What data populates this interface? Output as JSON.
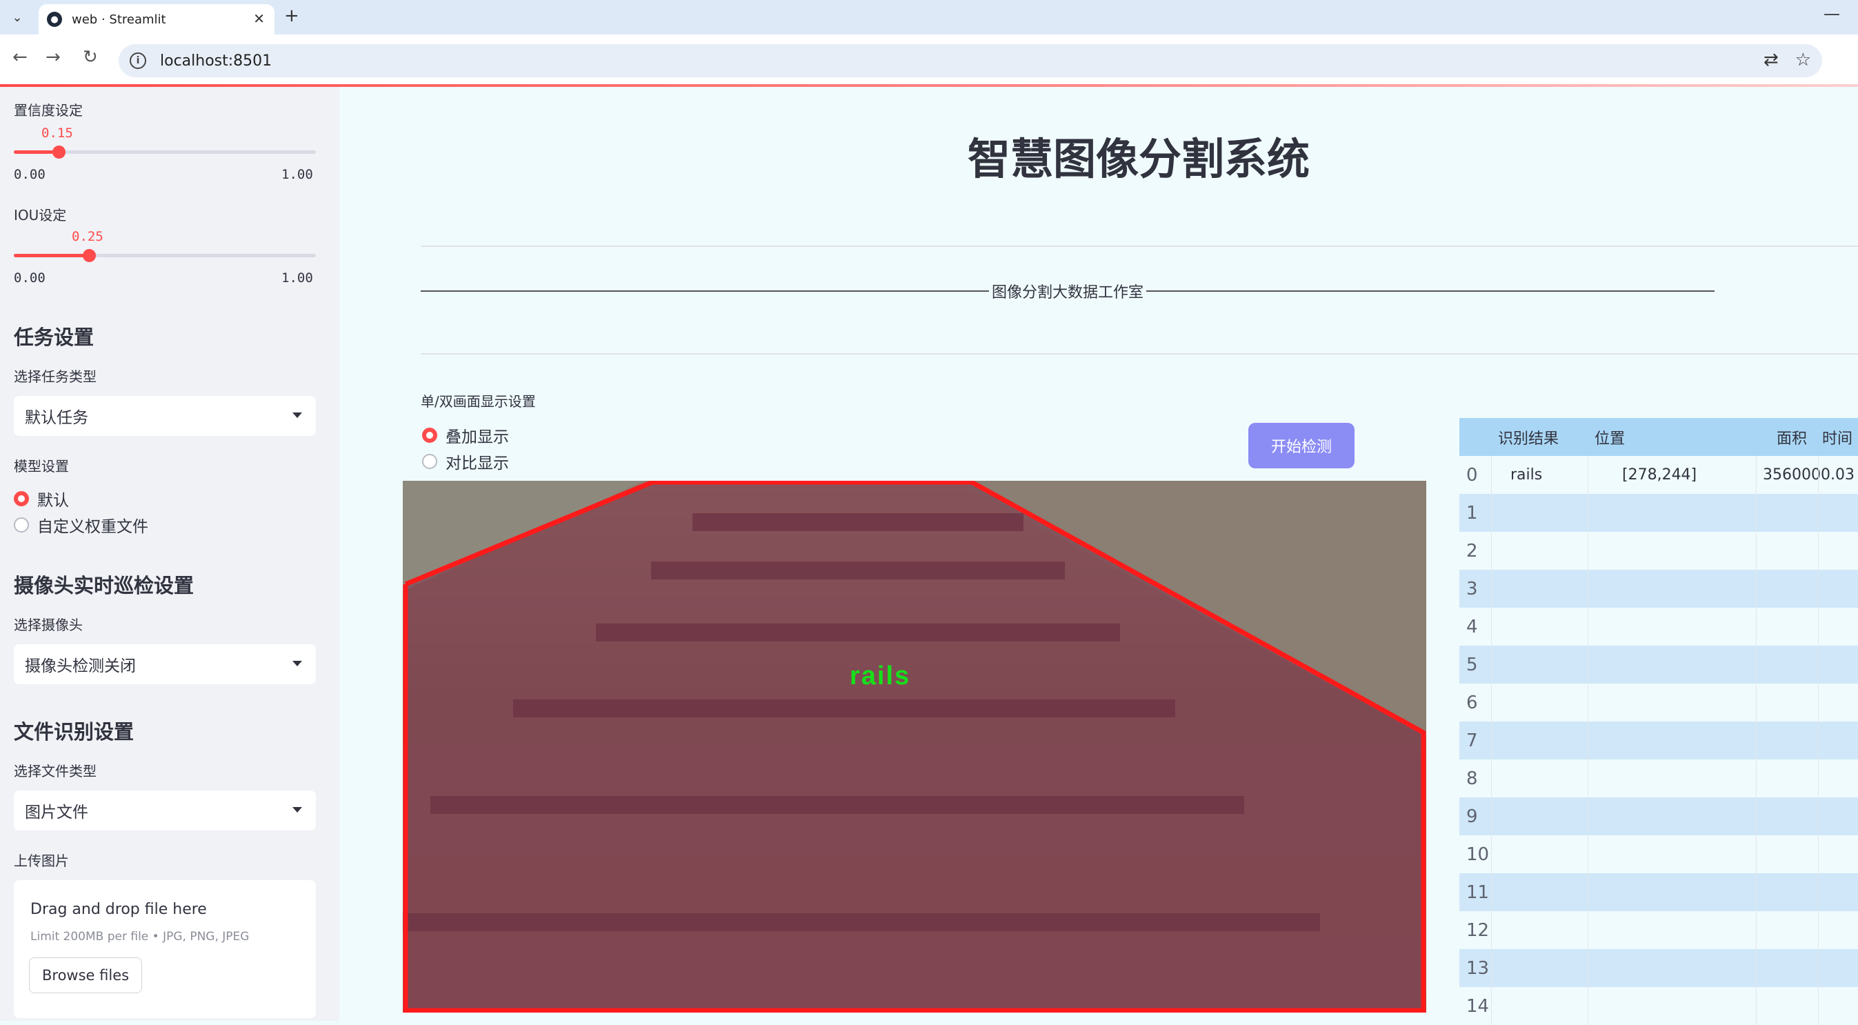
{
  "browser": {
    "tab_title": "web · Streamlit",
    "url": "localhost:8501"
  },
  "sidebar": {
    "confidence": {
      "label": "置信度设定",
      "value": "0.15",
      "min": "0.00",
      "max": "1.00",
      "fraction": 0.15
    },
    "iou": {
      "label": "IOU设定",
      "value": "0.25",
      "min": "0.00",
      "max": "1.00",
      "fraction": 0.25
    },
    "task_section": "任务设置",
    "task_type_label": "选择任务类型",
    "task_type_value": "默认任务",
    "model_label": "模型设置",
    "model_options": [
      "默认",
      "自定义权重文件"
    ],
    "camera_section": "摄像头实时巡检设置",
    "camera_label": "选择摄像头",
    "camera_value": "摄像头检测关闭",
    "file_section": "文件识别设置",
    "file_type_label": "选择文件类型",
    "file_type_value": "图片文件",
    "upload_label": "上传图片",
    "upload": {
      "title": "Drag and drop file here",
      "limit": "Limit 200MB per file • JPG, PNG, JPEG",
      "button": "Browse files"
    }
  },
  "main": {
    "title": "智慧图像分割系统",
    "studio": "图像分割大数据工作室",
    "display_label": "单/双画面显示设置",
    "display_options": [
      "叠加显示",
      "对比显示"
    ],
    "start_button": "开始检测",
    "segment_label": "rails"
  },
  "table": {
    "headers": [
      "识别结果",
      "位置",
      "面积",
      "时间"
    ],
    "rows": [
      {
        "idx": "0",
        "result": "rails",
        "position": "[278,244]",
        "area": "3560000.03",
        "time": ""
      },
      {
        "idx": "1",
        "result": "",
        "position": "",
        "area": "",
        "time": ""
      },
      {
        "idx": "2",
        "result": "",
        "position": "",
        "area": "",
        "time": ""
      },
      {
        "idx": "3",
        "result": "",
        "position": "",
        "area": "",
        "time": ""
      },
      {
        "idx": "4",
        "result": "",
        "position": "",
        "area": "",
        "time": ""
      },
      {
        "idx": "5",
        "result": "",
        "position": "",
        "area": "",
        "time": ""
      },
      {
        "idx": "6",
        "result": "",
        "position": "",
        "area": "",
        "time": ""
      },
      {
        "idx": "7",
        "result": "",
        "position": "",
        "area": "",
        "time": ""
      },
      {
        "idx": "8",
        "result": "",
        "position": "",
        "area": "",
        "time": ""
      },
      {
        "idx": "9",
        "result": "",
        "position": "",
        "area": "",
        "time": ""
      },
      {
        "idx": "10",
        "result": "",
        "position": "",
        "area": "",
        "time": ""
      },
      {
        "idx": "11",
        "result": "",
        "position": "",
        "area": "",
        "time": ""
      },
      {
        "idx": "12",
        "result": "",
        "position": "",
        "area": "",
        "time": ""
      },
      {
        "idx": "13",
        "result": "",
        "position": "",
        "area": "",
        "time": ""
      },
      {
        "idx": "14",
        "result": "",
        "position": "",
        "area": "",
        "time": ""
      }
    ]
  },
  "colors": {
    "accent": "#ff4b4b",
    "button": "#8c8cf5",
    "segment_outline": "#ff1a1a",
    "label_green": "#16e01a"
  }
}
